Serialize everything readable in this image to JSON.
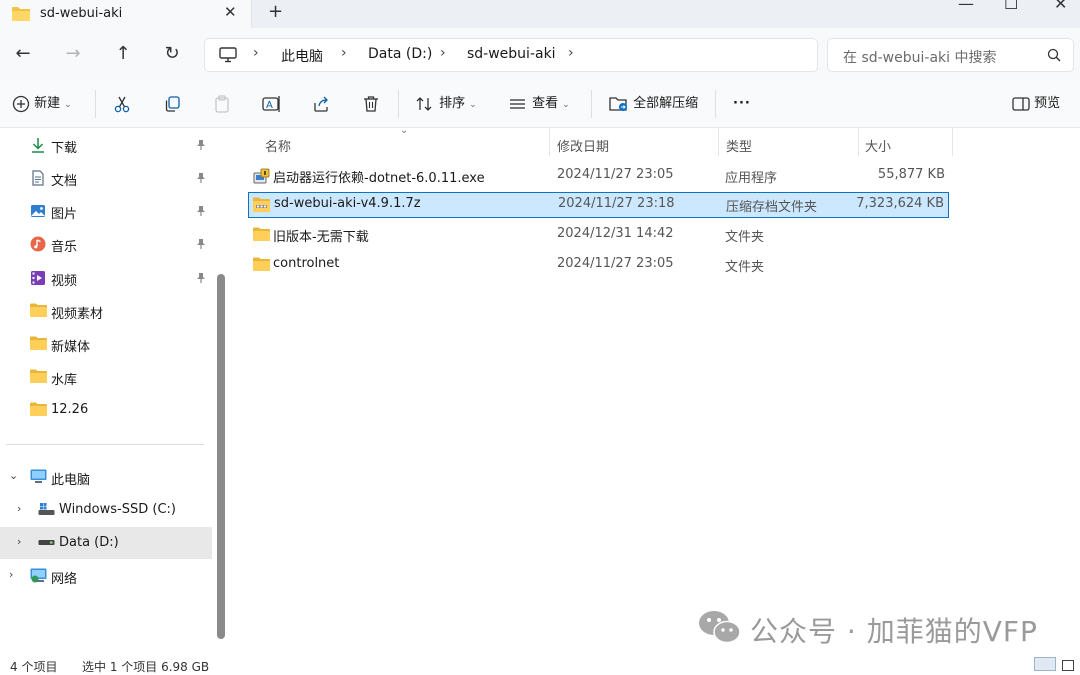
{
  "tab": {
    "title": "sd-webui-aki",
    "close": "✕",
    "new_tab": "+"
  },
  "window_controls": {
    "minimize": "—",
    "maximize": "☐",
    "close": "✕"
  },
  "nav": {
    "back": "←",
    "forward": "→",
    "up": "↑",
    "refresh": "↻"
  },
  "breadcrumb": [
    "此电脑",
    "Data (D:)",
    "sd-webui-aki"
  ],
  "search": {
    "placeholder": "在 sd-webui-aki 中搜索"
  },
  "toolbar": {
    "new_label": "新建",
    "sort_label": "排序",
    "view_label": "查看",
    "extract_label": "全部解压缩",
    "more_label": "···",
    "preview_label": "预览"
  },
  "sidebar": {
    "quick": [
      {
        "label": "下载",
        "icon": "download-icon",
        "pinned": true
      },
      {
        "label": "文档",
        "icon": "document-icon",
        "pinned": true
      },
      {
        "label": "图片",
        "icon": "pictures-icon",
        "pinned": true
      },
      {
        "label": "音乐",
        "icon": "music-icon",
        "pinned": true
      },
      {
        "label": "视频",
        "icon": "videos-icon",
        "pinned": true
      },
      {
        "label": "视频素材",
        "icon": "folder-icon",
        "pinned": false
      },
      {
        "label": "新媒体",
        "icon": "folder-icon",
        "pinned": false
      },
      {
        "label": "水库",
        "icon": "folder-icon",
        "pinned": false
      },
      {
        "label": "12.26",
        "icon": "folder-icon",
        "pinned": false
      }
    ],
    "this_pc": "此电脑",
    "drives": [
      {
        "label": "Windows-SSD (C:)",
        "icon": "windows-drive-icon",
        "selected": false
      },
      {
        "label": "Data (D:)",
        "icon": "drive-icon",
        "selected": true
      }
    ],
    "network": "网络"
  },
  "columns": {
    "name": "名称",
    "date": "修改日期",
    "type": "类型",
    "size": "大小"
  },
  "files": [
    {
      "name": "启动器运行依赖-dotnet-6.0.11.exe",
      "date": "2024/11/27 23:05",
      "type": "应用程序",
      "size": "55,877 KB",
      "icon": "installer-icon",
      "selected": false
    },
    {
      "name": "sd-webui-aki-v4.9.1.7z",
      "date": "2024/11/27 23:18",
      "type": "压缩存档文件夹",
      "size": "7,323,624 KB",
      "icon": "zip-folder-icon",
      "selected": true
    },
    {
      "name": "旧版本-无需下载",
      "date": "2024/12/31 14:42",
      "type": "文件夹",
      "size": "",
      "icon": "folder-icon",
      "selected": false
    },
    {
      "name": "controlnet",
      "date": "2024/11/27 23:05",
      "type": "文件夹",
      "size": "",
      "icon": "folder-icon",
      "selected": false
    }
  ],
  "watermark": "公众号 · 加菲猫的VFP",
  "status": {
    "items": "4 个项目",
    "selection": "选中 1 个项目 6.98 GB"
  },
  "colors": {
    "selection_bg": "#cce8ff",
    "selection_border": "#0a73c8",
    "folder": "#f4c144",
    "accent": "#0a73c8"
  }
}
